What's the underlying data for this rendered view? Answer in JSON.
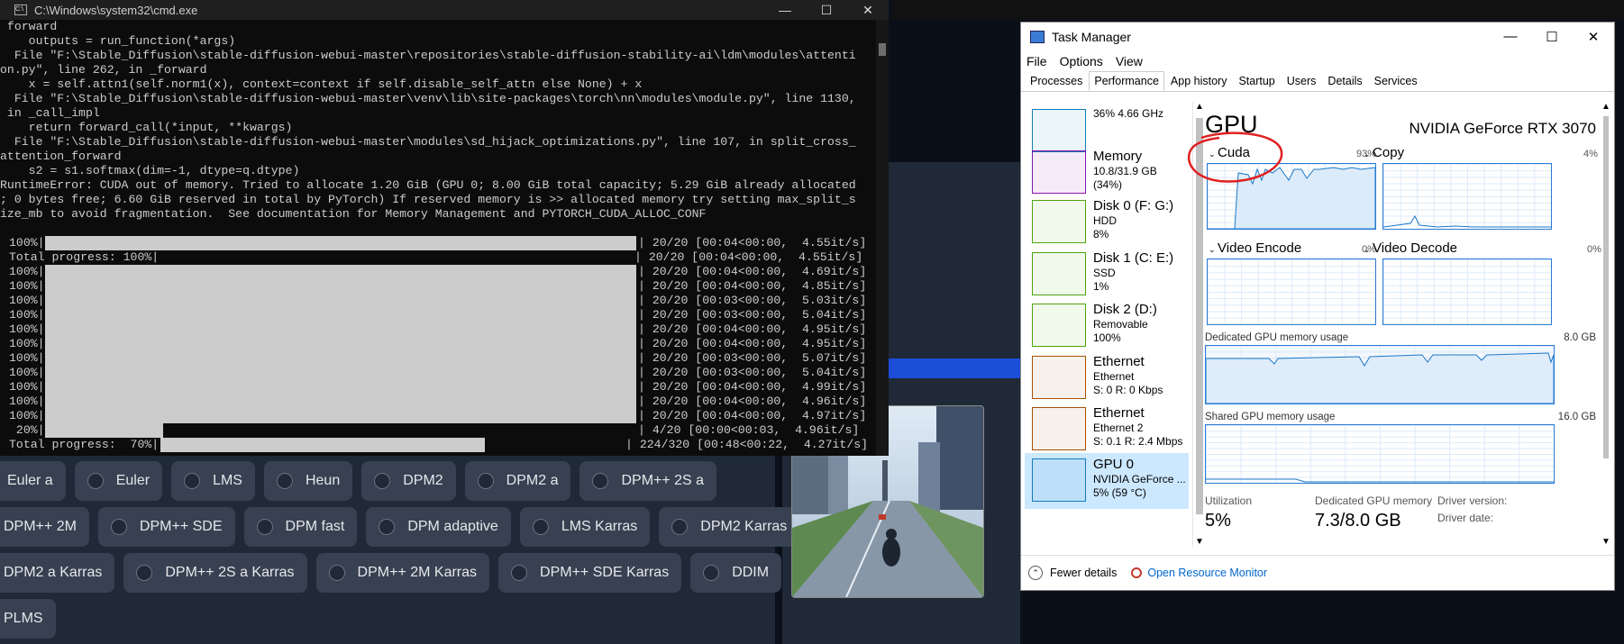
{
  "cmd": {
    "title": "C:\\Windows\\system32\\cmd.exe",
    "lines": [
      " forward",
      "    outputs = run_function(*args)",
      "  File \"F:\\Stable_Diffusion\\stable-diffusion-webui-master\\repositories\\stable-diffusion-stability-ai\\ldm\\modules\\attenti",
      "on.py\", line 262, in _forward",
      "    x = self.attn1(self.norm1(x), context=context if self.disable_self_attn else None) + x",
      "  File \"F:\\Stable_Diffusion\\stable-diffusion-webui-master\\venv\\lib\\site-packages\\torch\\nn\\modules\\module.py\", line 1130,",
      " in _call_impl",
      "    return forward_call(*input, **kwargs)",
      "  File \"F:\\Stable_Diffusion\\stable-diffusion-webui-master\\modules\\sd_hijack_optimizations.py\", line 107, in split_cross_",
      "attention_forward",
      "    s2 = s1.softmax(dim=-1, dtype=q.dtype)",
      "RuntimeError: CUDA out of memory. Tried to allocate 1.20 GiB (GPU 0; 8.00 GiB total capacity; 5.29 GiB already allocated",
      "; 0 bytes free; 6.60 GiB reserved in total by PyTorch) If reserved memory is >> allocated memory try setting max_split_s",
      "ize_mb to avoid fragmentation.  See documentation for Memory Management and PYTORCH_CUDA_ALLOC_CONF"
    ],
    "progress": [
      {
        "left": "100%|",
        "right": "| 20/20 [00:04<00:00,  4.55it/s]"
      },
      {
        "left": "Total progress: 100%|",
        "right": "| 20/20 [00:04<00:00,  4.55it/s]"
      },
      {
        "left": "100%|",
        "right": "| 20/20 [00:04<00:00,  4.69it/s]"
      },
      {
        "left": "100%|",
        "right": "| 20/20 [00:04<00:00,  4.85it/s]"
      },
      {
        "left": "100%|",
        "right": "| 20/20 [00:03<00:00,  5.03it/s]"
      },
      {
        "left": "100%|",
        "right": "| 20/20 [00:03<00:00,  5.04it/s]"
      },
      {
        "left": "100%|",
        "right": "| 20/20 [00:04<00:00,  4.95it/s]"
      },
      {
        "left": "100%|",
        "right": "| 20/20 [00:04<00:00,  4.95it/s]"
      },
      {
        "left": "100%|",
        "right": "| 20/20 [00:03<00:00,  5.07it/s]"
      },
      {
        "left": "100%|",
        "right": "| 20/20 [00:03<00:00,  5.04it/s]"
      },
      {
        "left": "100%|",
        "right": "| 20/20 [00:04<00:00,  4.99it/s]"
      },
      {
        "left": "100%|",
        "right": "| 20/20 [00:04<00:00,  4.96it/s]"
      },
      {
        "left": "100%|",
        "right": "| 20/20 [00:04<00:00,  4.97it/s]"
      },
      {
        "left": " 20%|",
        "right": "| 4/20 [00:00<00:03,  4.96it/s]"
      },
      {
        "left": "Total progress:  70%|",
        "right": "| 224/320 [00:48<00:22,  4.27it/s]"
      }
    ]
  },
  "samplers": {
    "row1": [
      "Euler a",
      "Euler",
      "LMS",
      "Heun",
      "DPM2",
      "DPM2 a",
      "DPM++ 2S a"
    ],
    "row2": [
      "DPM++ 2M",
      "DPM++ SDE",
      "DPM fast",
      "DPM adaptive",
      "LMS Karras",
      "DPM2 Karras"
    ],
    "row3": [
      "DPM2 a Karras",
      "DPM++ 2S a Karras",
      "DPM++ 2M Karras",
      "DPM++ SDE Karras",
      "DDIM"
    ],
    "row4": [
      "PLMS"
    ]
  },
  "taskmanager": {
    "title": "Task Manager",
    "menu": [
      "File",
      "Options",
      "View"
    ],
    "tabs": [
      "Processes",
      "Performance",
      "App history",
      "Startup",
      "Users",
      "Details",
      "Services"
    ],
    "active_tab": "Performance",
    "resources": [
      {
        "name": "",
        "sub1": "36% 4.66 GHz",
        "sub2": "",
        "color": "#117dbb"
      },
      {
        "name": "Memory",
        "sub1": "10.8/31.9 GB (34%)",
        "sub2": "",
        "color": "#8b12ae"
      },
      {
        "name": "Disk 0 (F: G:)",
        "sub1": "HDD",
        "sub2": "8%",
        "color": "#4da60c"
      },
      {
        "name": "Disk 1 (C: E:)",
        "sub1": "SSD",
        "sub2": "1%",
        "color": "#4da60c"
      },
      {
        "name": "Disk 2 (D:)",
        "sub1": "Removable",
        "sub2": "100%",
        "color": "#4da60c"
      },
      {
        "name": "Ethernet",
        "sub1": "Ethernet",
        "sub2": "S: 0  R: 0 Kbps",
        "color": "#a74f01"
      },
      {
        "name": "Ethernet",
        "sub1": "Ethernet 2",
        "sub2": "S: 0.1  R: 2.4 Mbps",
        "color": "#a74f01"
      },
      {
        "name": "GPU 0",
        "sub1": "NVIDIA GeForce ...",
        "sub2": "5% (59 °C)",
        "color": "#117dbb"
      }
    ],
    "gpu": {
      "heading": "GPU",
      "model": "NVIDIA GeForce RTX 3070",
      "engines": [
        {
          "label": "Cuda",
          "pct": "93%"
        },
        {
          "label": "Copy",
          "pct": "4%"
        },
        {
          "label": "Video Encode",
          "pct": "0%"
        },
        {
          "label": "Video Decode",
          "pct": "0%"
        }
      ],
      "dedicated_label": "Dedicated GPU memory usage",
      "dedicated_max": "8.0 GB",
      "shared_label": "Shared GPU memory usage",
      "shared_max": "16.0 GB",
      "utilization_label": "Utilization",
      "utilization": "5%",
      "dedicated_mem_label": "Dedicated GPU memory",
      "dedicated_mem": "7.3/8.0 GB",
      "driver_version_label": "Driver version:",
      "driver_date_label": "Driver date:"
    },
    "footer": {
      "fewer": "Fewer details",
      "monitor": "Open Resource Monitor"
    }
  }
}
